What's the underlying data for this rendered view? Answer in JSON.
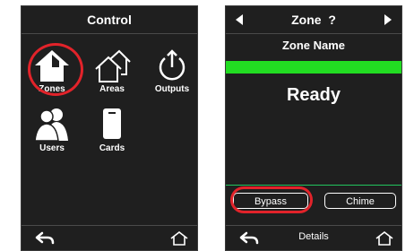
{
  "left_screen": {
    "title": "Control",
    "tiles": [
      {
        "label": "Zones",
        "icon": "house-zones-icon"
      },
      {
        "label": "Areas",
        "icon": "houses-areas-icon"
      },
      {
        "label": "Outputs",
        "icon": "power-icon"
      },
      {
        "label": "Users",
        "icon": "users-icon"
      },
      {
        "label": "Cards",
        "icon": "card-icon"
      }
    ],
    "footer": {
      "back_icon": "back-arrow-icon",
      "home_icon": "home-icon"
    }
  },
  "right_screen": {
    "title": "Zone  ?",
    "subtitle": "Zone Name",
    "state": "Ready",
    "buttons": {
      "bypass": "Bypass",
      "chime": "Chime"
    },
    "footer": {
      "details": "Details",
      "back_icon": "back-arrow-icon",
      "home_icon": "home-icon"
    }
  },
  "colors": {
    "accent_ring": "#e2232a",
    "status_bar": "#22dd22",
    "screen_bg": "#1f1f1f"
  }
}
